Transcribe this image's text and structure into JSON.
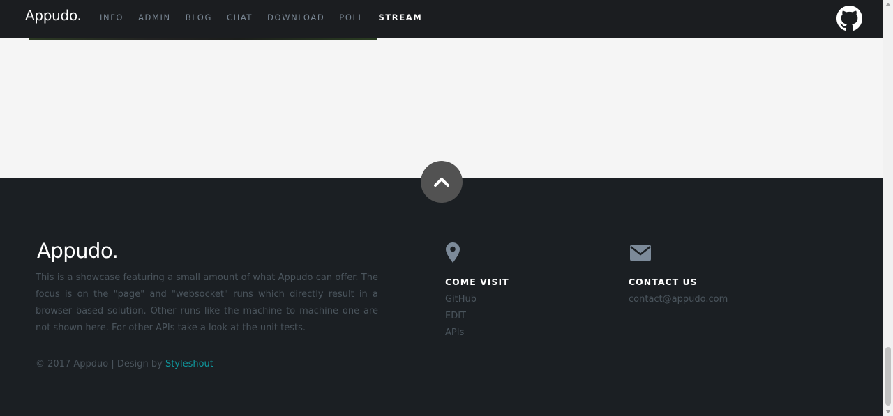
{
  "header": {
    "logo": "Appudo.",
    "nav": [
      {
        "label": "INFO",
        "active": false
      },
      {
        "label": "ADMIN",
        "active": false
      },
      {
        "label": "BLOG",
        "active": false
      },
      {
        "label": "CHAT",
        "active": false
      },
      {
        "label": "DOWNLOAD",
        "active": false
      },
      {
        "label": "POLL",
        "active": false
      },
      {
        "label": "STREAM",
        "active": true
      }
    ],
    "github_icon": "github-icon"
  },
  "footer": {
    "logo": "Appudo.",
    "description": "This is a showcase featuring a small amount of what Appudo can offer. The focus is on the \"page\" and \"websocket\" runs which directly result in a browser based solution. Other runs like the machine to machine one are not shown here. For other APIs take a look at the unit tests.",
    "copyright_prefix": "© 2017 Appduo | Design by ",
    "copyright_link": "Styleshout",
    "visit": {
      "icon": "map-pin-icon",
      "title": "COME VISIT",
      "links": [
        "GitHub",
        "EDIT",
        "APIs"
      ]
    },
    "contact": {
      "icon": "envelope-icon",
      "title": "CONTACT US",
      "email": "contact@appudo.com"
    },
    "go_top_icon": "chevron-up-icon"
  },
  "colors": {
    "header_bg": "#1b1d20",
    "footer_bg": "#1b1f23",
    "content_bg": "#f5f5f5",
    "accent_link": "#0f9aa0",
    "muted_text": "#4a545c",
    "nav_text": "#7a8794",
    "icon_color": "#7c8a99"
  }
}
